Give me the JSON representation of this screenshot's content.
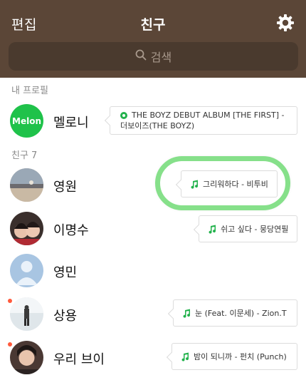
{
  "header": {
    "edit_label": "편집",
    "title": "친구",
    "settings_icon": "gear-icon",
    "background": "#5b4637"
  },
  "search": {
    "placeholder": "검색",
    "icon": "search-icon"
  },
  "sections": {
    "my_profile": "내 프로필",
    "friends": "친구 7"
  },
  "my_profile": {
    "name": "멜로니",
    "avatar_text": "Melon",
    "status_line1": "THE BOYZ DEBUT ALBUM [THE FIRST] -",
    "status_line2": "더보이즈(THE BOYZ)"
  },
  "friends": [
    {
      "name": "영원",
      "status": "그리워하다 - 비투비",
      "new": false,
      "highlighted": true
    },
    {
      "name": "이명수",
      "status": "쉬고 싶다 - 뭉당연필",
      "new": false
    },
    {
      "name": "영민",
      "status": "",
      "new": false
    },
    {
      "name": "상용",
      "status": "눈 (Feat. 이문세) - Zion.T",
      "new": true
    },
    {
      "name": "우리 브이",
      "status": "밤이 되니까 - 펀치 (Punch)",
      "new": true
    }
  ],
  "colors": {
    "accent_green": "#22b24c",
    "highlight_ring": "#86e08a",
    "new_dot": "#ff5a3c"
  }
}
